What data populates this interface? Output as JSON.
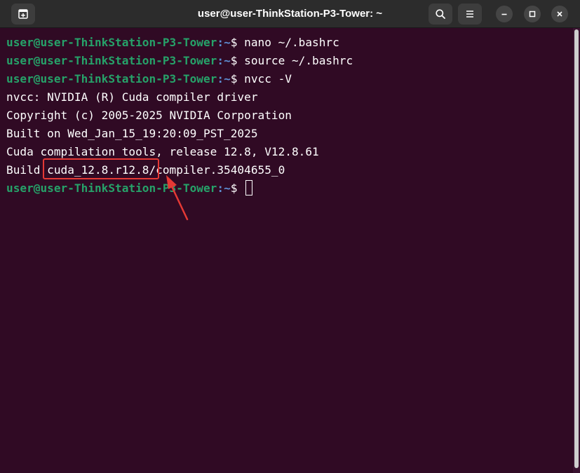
{
  "window": {
    "title": "user@user-ThinkStation-P3-Tower: ~"
  },
  "header": {
    "new_tab_icon": "new-tab-icon",
    "search_icon": "search-icon",
    "menu_icon": "hamburger-menu-icon",
    "minimize_icon": "minimize-icon",
    "maximize_icon": "maximize-icon",
    "close_icon": "close-icon"
  },
  "prompt": {
    "user_host": "user@user-ThinkStation-P3-Tower",
    "path": ":~",
    "symbol": "$ "
  },
  "lines": [
    {
      "type": "cmd",
      "text": "nano ~/.bashrc"
    },
    {
      "type": "cmd",
      "text": "source ~/.bashrc"
    },
    {
      "type": "cmd",
      "text": "nvcc -V"
    },
    {
      "type": "out",
      "text": "nvcc: NVIDIA (R) Cuda compiler driver"
    },
    {
      "type": "out",
      "text": "Copyright (c) 2005-2025 NVIDIA Corporation"
    },
    {
      "type": "out",
      "text": "Built on Wed_Jan_15_19:20:09_PST_2025"
    },
    {
      "type": "out",
      "text": "Cuda compilation tools, release 12.8, V12.8.61"
    },
    {
      "type": "out",
      "text": "Build cuda_12.8.r12.8/compiler.35404655_0"
    }
  ],
  "colors": {
    "background": "#300a24",
    "prompt_user": "#26a269",
    "prompt_path": "#5e8fd4",
    "annotation": "#e53935"
  }
}
